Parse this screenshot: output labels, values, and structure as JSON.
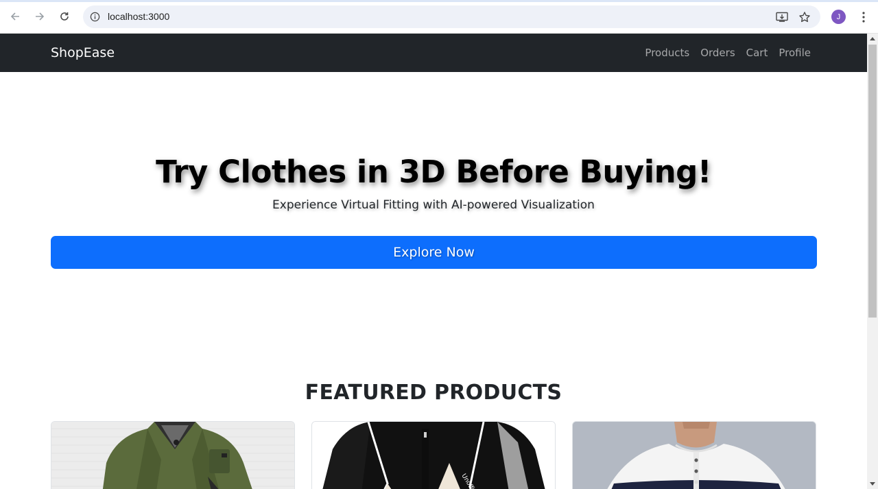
{
  "browser": {
    "url": "localhost:3000",
    "avatar_initial": "J",
    "icons": [
      "back-arrow-icon",
      "forward-arrow-icon",
      "reload-icon",
      "site-info-icon",
      "install-app-icon",
      "bookmark-star-icon",
      "menu-kebab-icon"
    ]
  },
  "navbar": {
    "brand": "ShopEase",
    "links": [
      "Products",
      "Orders",
      "Cart",
      "Profile"
    ]
  },
  "hero": {
    "title": "Try Clothes in 3D Before Buying!",
    "subtitle": "Experience Virtual Fitting with AI-powered Visualization",
    "cta_label": "Explore Now"
  },
  "featured": {
    "title": "FEATURED PRODUCTS",
    "products": [
      {
        "image": "olive-green-jacket"
      },
      {
        "image": "black-white-windbreaker",
        "print": "Unofficial"
      },
      {
        "image": "white-navy-striped-henley"
      }
    ]
  },
  "colors": {
    "navbar_bg": "#212529",
    "primary": "#0d6efd",
    "avatar": "#7e57c2"
  }
}
